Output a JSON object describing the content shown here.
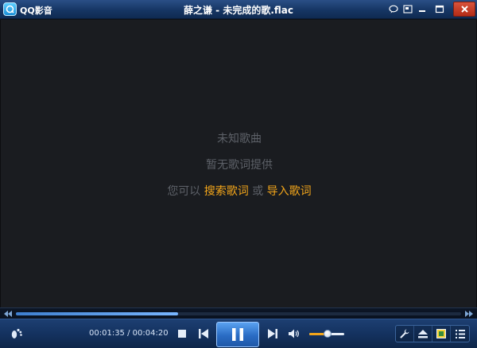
{
  "app": {
    "name": "QQ影音",
    "window_title": "薛之谦 - 未完成的歌.flac"
  },
  "titlebar_buttons": [
    "chat-icon",
    "mini-mode-icon",
    "minimize-icon",
    "maximize-icon",
    "close-icon"
  ],
  "lyrics_panel": {
    "song_status": "未知歌曲",
    "lyrics_status": "暂无歌词提供",
    "prompt_prefix": "您可以",
    "search_link": "搜索歌词",
    "or_text": "或",
    "import_link": "导入歌词"
  },
  "playback": {
    "current_time": "00:01:35",
    "separator": " / ",
    "total_time": "00:04:20",
    "progress": 0.365,
    "volume": 0.55
  },
  "colors": {
    "accent": "#f2a51a",
    "titlebar": "#163664",
    "background": "#1a1c20",
    "play_button": "#2a6cc4"
  },
  "controls": [
    "footprint-icon",
    "stop-icon",
    "previous-icon",
    "pause-icon",
    "next-icon",
    "volume-icon",
    "settings-wrench-icon",
    "eject-icon",
    "screenshot-icon",
    "playlist-icon"
  ]
}
